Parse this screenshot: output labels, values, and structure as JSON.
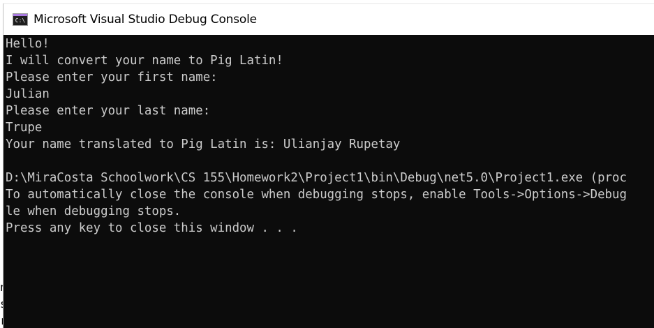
{
  "background": {
    "partial_lines": [
      "n",
      "s",
      "r"
    ]
  },
  "window": {
    "title": "Microsoft Visual Studio Debug Console",
    "icon": {
      "name": "console-app-icon",
      "text": "C:\\"
    }
  },
  "console": {
    "colors": {
      "background": "#0c0c0c",
      "text": "#cccccc"
    },
    "lines": [
      "Hello!",
      "I will convert your name to Pig Latin!",
      "Please enter your first name:",
      "Julian",
      "Please enter your last name:",
      "Trupe",
      "Your name translated to Pig Latin is: Ulianjay Rupetay",
      "",
      "D:\\MiraCosta Schoolwork\\CS 155\\Homework2\\Project1\\bin\\Debug\\net5.0\\Project1.exe (proc",
      "To automatically close the console when debugging stops, enable Tools->Options->Debug",
      "le when debugging stops.",
      "Press any key to close this window . . ."
    ]
  }
}
